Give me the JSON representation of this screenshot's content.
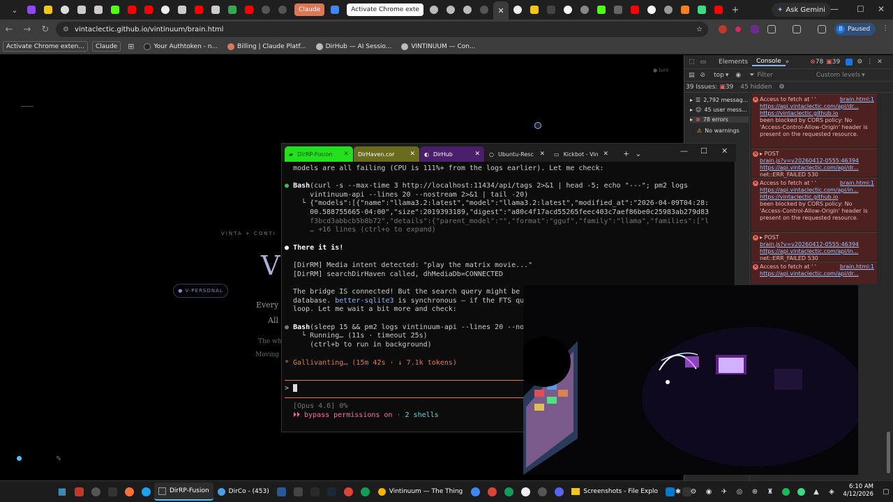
{
  "browser": {
    "tabs": [
      {
        "name": "claude",
        "label": "Claude",
        "color": "#d97757"
      },
      {
        "name": "activate-chrome",
        "label": "Activate Chrome exte",
        "color": "#1a73e8"
      }
    ],
    "gemini_label": "Ask Gemini",
    "url": "vintaclectic.github.io/vintinuum/brain.html",
    "profile_initial": "B",
    "profile_status": "Paused",
    "bookmarks": [
      {
        "label": "Activate Chrome exten...",
        "boxed": true
      },
      {
        "label": "Claude",
        "boxed": true
      },
      {
        "label": "Your Authtoken - n...",
        "boxed": false
      },
      {
        "label": "Billing | Claude Platf...",
        "boxed": false
      },
      {
        "label": "DirHub — AI Sessio...",
        "boxed": false
      },
      {
        "label": "VINTINUUM — Con...",
        "boxed": false
      }
    ]
  },
  "page": {
    "corner_label": "● lore",
    "subtitle": "VINTA + CONTI",
    "big_letter": "V",
    "badge": "● V-PERSONAL",
    "line1": "Every b",
    "line2": "All c",
    "line3": "The whi",
    "line4": "Moving c"
  },
  "devtools": {
    "tabs": [
      "Elements",
      "Console"
    ],
    "error_count": "78",
    "warning_count": "39",
    "context": "top",
    "filter_placeholder": "Filter",
    "levels": "Custom levels",
    "issues": "39 Issues:",
    "issues_count": "39",
    "hidden": "45 hidden",
    "sidebar": [
      {
        "label": "2,792 messag...",
        "icon": "list"
      },
      {
        "label": "45 user mess...",
        "icon": "user"
      },
      {
        "label": "78 errors",
        "icon": "error"
      },
      {
        "label": "No warnings",
        "icon": "warning"
      }
    ],
    "messages": [
      {
        "type": "cors",
        "source": "brain.html:1",
        "url": "https://api.vintaclectic.com/api/dr...",
        "origin": "https://vintaclectic.github.io",
        "text": "Access to fetch at ' ' from origin ' ' has been blocked by CORS policy: No 'Access-Control-Allow-Origin' header is present on the requested resource."
      },
      {
        "type": "post",
        "source": "brain.js?v=v20260412-0555:46394",
        "url": "https://api.vintaclectic.com/api/dr...",
        "text": "net::ERR_FAILED 530"
      },
      {
        "type": "cors",
        "source": "brain.html:1",
        "url": "https://api.vintaclectic.com/api/in...",
        "origin": "https://vintaclectic.github.io",
        "text": "Access to fetch at ' ' from origin ' ' has been blocked by CORS policy: No 'Access-Control-Allow-Origin' header is present on the requested resource."
      },
      {
        "type": "post",
        "source": "brain.js?v=v20260412-0555:46394",
        "url": "https://api.vintaclectic.com/api/in...",
        "text": "net::ERR_FAILED 530"
      },
      {
        "type": "cors",
        "source": "brain.html:1",
        "url": "https://api.vintaclectic.com/api/dr...",
        "text": "Access to fetch at ' ' from origin ' '"
      }
    ]
  },
  "terminal": {
    "tabs": [
      {
        "label": "DirRP-Fusion",
        "color": "#22e01b",
        "text_color": "#0a3d0a"
      },
      {
        "label": "DirHaven.cor",
        "color": "#6b6b1f",
        "text_color": "#fff"
      },
      {
        "label": "DirHub",
        "color": "#4a1f6b",
        "text_color": "#fff"
      },
      {
        "label": "Ubuntu-Resc",
        "color": "#1e1e1e",
        "text_color": "#ddd"
      },
      {
        "label": "Kickbot - Vin",
        "color": "#1e1e1e",
        "text_color": "#ddd"
      }
    ],
    "lines": {
      "l0": "models are all failing (CPU is 111%+ from the logs earlier). Let me check:",
      "l1_cmd": "Bash",
      "l1_args": "(curl -s --max-time 3 http://localhost:11434/api/tags 2>&1 | head -5; echo \"---\"; pm2 logs",
      "l2": "    vintinuum-api --lines 20 --nostream 2>&1 | tail -20)",
      "l3": "  └ {\"models\":[{\"name\":\"llama3.2:latest\",\"model\":\"llama3.2:latest\",\"modified_at\":\"2026-04-09T04:28:",
      "l4": "    00.588755665-04:00\",\"size\":2019393189,\"digest\":\"a80c4f17acd55265feec403c7aef86be0c25983ab279d83",
      "l5": "    f3bcd3abbcb5b8b72\",\"details\":{\"parent_model\":\"\",\"format\":\"gguf\",\"family\":\"llama\",\"families\":[\"l",
      "l6": "    … +16 lines (ctrl+o to expand)",
      "l7": "There it is!",
      "l8": "[DirRM] Media intent detected: \"play the matrix movie...\"",
      "l9": "[DirRM] searchDirHaven called, dhMediaDb=CONNECTED",
      "l10": "The bridge IS connected! But the search query might be",
      "l11a": "database. ",
      "l11b": "better-sqlite3",
      "l11c": " is synchronous — if the FTS qu",
      "l12": "loop. Let me wait a bit more and check:",
      "l13_cmd": "Bash",
      "l13_args": "(sleep 15 && pm2 logs vintinuum-api --lines 20 --no",
      "l14": "  └ Running… (11s · timeout 25s)",
      "l15": "    (ctrl+b to run in background)",
      "l16": "* Gallivanting… (15m 42s · ↓ 7.1k tokens)",
      "prompt": ">",
      "model": "[Opus 4.6] 0%",
      "perm_a": "⏵⏵ bypass permissions on",
      "perm_b": " · ",
      "perm_c": "2 shells"
    }
  },
  "taskbar": {
    "apps": [
      {
        "label": "DirRP-Fusion",
        "active": true
      },
      {
        "label": "DirCo - (453)",
        "active": false
      },
      {
        "label": "Vintinuum — The Thing",
        "active": false
      },
      {
        "label": "Screenshots - File Explo",
        "active": false
      }
    ],
    "time": "6:10 AM",
    "date": "4/12/2026"
  }
}
